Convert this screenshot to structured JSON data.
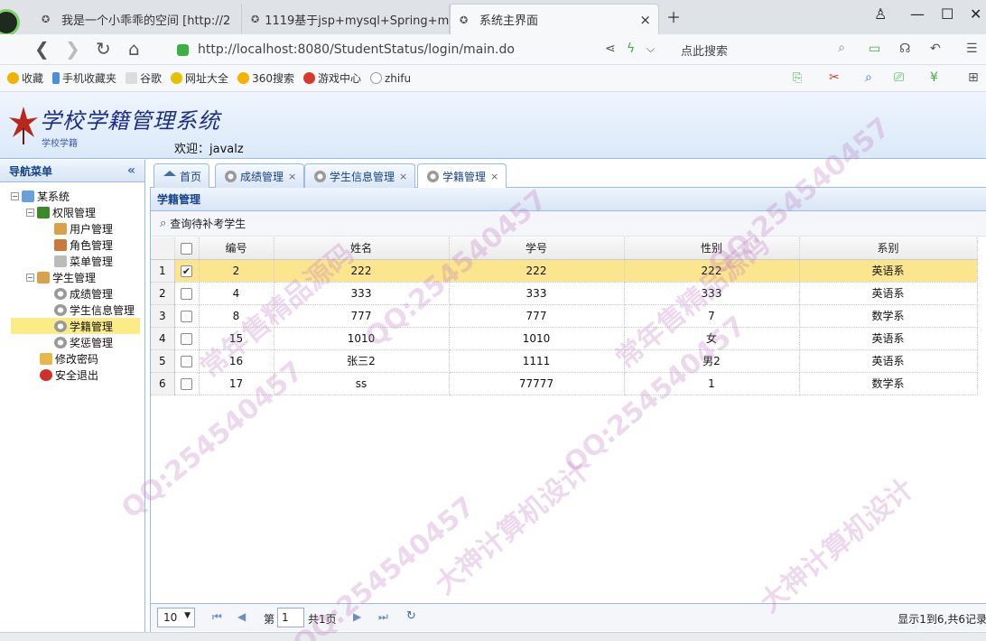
{
  "browser": {
    "tabs": [
      {
        "title": "我是一个小乖乖的空间 [http://2"
      },
      {
        "title": "1119基于jsp+mysql+Spring+m"
      },
      {
        "title": "系统主界面"
      }
    ],
    "url": "http://localhost:8080/StudentStatus/login/main.do",
    "search_placeholder": "点此搜索",
    "bookmarks": [
      "收藏",
      "手机收藏夹",
      "谷歌",
      "网址大全",
      "360搜索",
      "游戏中心",
      "zhifu"
    ]
  },
  "app": {
    "title": "学校学籍管理系统",
    "subtitle": "学校学籍",
    "welcome": "欢迎：javalz"
  },
  "sidebar": {
    "header": "导航菜单",
    "collapse_glyph": "«",
    "tree": [
      {
        "label": "某系统",
        "level": 0
      },
      {
        "label": "权限管理",
        "level": 1
      },
      {
        "label": "用户管理",
        "level": 2
      },
      {
        "label": "角色管理",
        "level": 2
      },
      {
        "label": "菜单管理",
        "level": 2
      },
      {
        "label": "学生管理",
        "level": 1
      },
      {
        "label": "成绩管理",
        "level": 2
      },
      {
        "label": "学生信息管理",
        "level": 2
      },
      {
        "label": "学籍管理",
        "level": 2,
        "selected": true
      },
      {
        "label": "奖惩管理",
        "level": 2
      },
      {
        "label": "修改密码",
        "level": 1
      },
      {
        "label": "安全退出",
        "level": 1
      }
    ]
  },
  "tabs": [
    {
      "label": "首页",
      "closable": false
    },
    {
      "label": "成绩管理",
      "closable": true
    },
    {
      "label": "学生信息管理",
      "closable": true
    },
    {
      "label": "学籍管理",
      "closable": true,
      "active": true
    }
  ],
  "panel": {
    "title": "学籍管理",
    "toolbar_button": "查询待补考学生"
  },
  "grid": {
    "columns": [
      "编号",
      "姓名",
      "学号",
      "性别",
      "系别"
    ],
    "rows": [
      {
        "n": "1",
        "checked": true,
        "cells": [
          "2",
          "222",
          "222",
          "222",
          "英语系"
        ]
      },
      {
        "n": "2",
        "checked": false,
        "cells": [
          "4",
          "333",
          "333",
          "333",
          "英语系"
        ]
      },
      {
        "n": "3",
        "checked": false,
        "cells": [
          "8",
          "777",
          "777",
          "7",
          "数学系"
        ]
      },
      {
        "n": "4",
        "checked": false,
        "cells": [
          "15",
          "1010",
          "1010",
          "女",
          "英语系"
        ]
      },
      {
        "n": "5",
        "checked": false,
        "cells": [
          "16",
          "张三2",
          "1111",
          "男2",
          "英语系"
        ]
      },
      {
        "n": "6",
        "checked": false,
        "cells": [
          "17",
          "ss",
          "77777",
          "1",
          "数学系"
        ]
      }
    ]
  },
  "pager": {
    "page_size": "10",
    "page_label": "第",
    "page_number": "1",
    "total_pages": "共1页",
    "info": "显示1到6,共6记录"
  },
  "watermark": [
    "QQ:254540457",
    "常年售精品源码",
    "大神计算机设计"
  ],
  "colors": {
    "accent": "#99bbe8",
    "selected_row": "#fbe58e",
    "header_text": "#15428b"
  }
}
